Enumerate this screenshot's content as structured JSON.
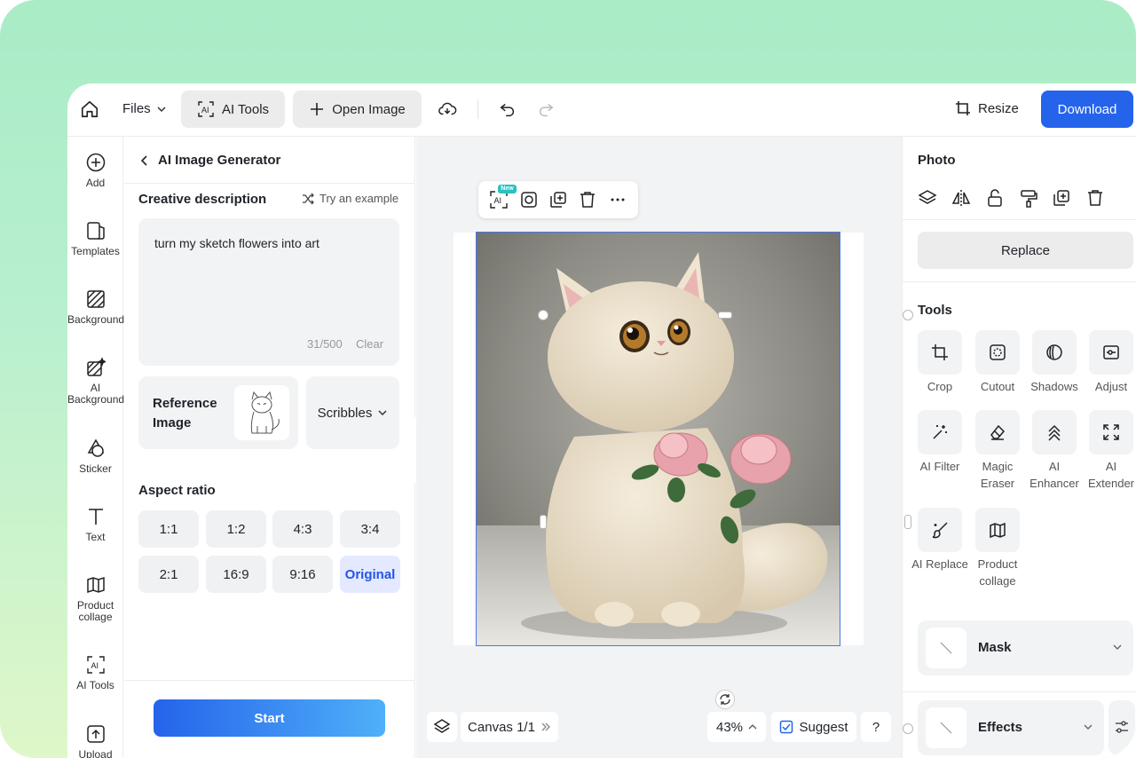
{
  "topbar": {
    "files_label": "Files",
    "ai_tools_label": "AI Tools",
    "open_image_label": "Open Image",
    "resize_label": "Resize",
    "download_label": "Download"
  },
  "rail": {
    "items": [
      {
        "label": "Add",
        "icon": "plus-circle-icon"
      },
      {
        "label": "Templates",
        "icon": "templates-icon"
      },
      {
        "label": "Background",
        "icon": "background-icon"
      },
      {
        "label": "AI Background",
        "icon": "ai-background-icon"
      },
      {
        "label": "Sticker",
        "icon": "sticker-icon"
      },
      {
        "label": "Text",
        "icon": "text-icon"
      },
      {
        "label": "Product collage",
        "icon": "product-collage-icon"
      },
      {
        "label": "AI Tools",
        "icon": "ai-tools-icon"
      },
      {
        "label": "Upload",
        "icon": "upload-icon"
      }
    ]
  },
  "panel": {
    "title": "AI Image Generator",
    "creative_title": "Creative description",
    "try_example": "Try an example",
    "description": "turn my sketch flowers into art",
    "count": "31/500",
    "clear": "Clear",
    "reference_label": "Reference Image",
    "scribbles_label": "Scribbles",
    "aspect_title": "Aspect ratio",
    "ratios": [
      "1:1",
      "1:2",
      "4:3",
      "3:4",
      "2:1",
      "16:9",
      "9:16",
      "Original"
    ],
    "active_ratio": "Original",
    "start_label": "Start"
  },
  "canvas": {
    "new_badge": "New",
    "canvas_label": "Canvas 1/1",
    "zoom": "43%",
    "suggest_label": "Suggest",
    "help_label": "?"
  },
  "rpanel": {
    "photo_title": "Photo",
    "replace_label": "Replace",
    "tools_title": "Tools",
    "tools": [
      "Crop",
      "Cutout",
      "Shadows",
      "Adjust",
      "AI Filter",
      "Magic Eraser",
      "AI Enhancer",
      "AI Extender",
      "AI Replace",
      "Product collage"
    ],
    "mask_label": "Mask",
    "effects_label": "Effects"
  },
  "colors": {
    "accent": "#2563eb",
    "frame_green": "#a9ecc6",
    "selection": "#4a74ee"
  }
}
